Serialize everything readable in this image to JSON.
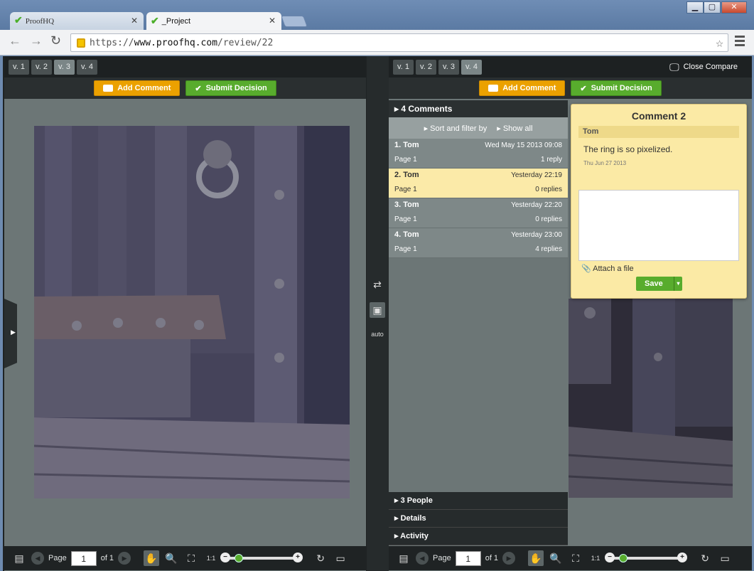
{
  "browser": {
    "tabs": [
      {
        "label": "ProofHQ"
      },
      {
        "label": "_Project"
      }
    ],
    "url_prefix": "https://",
    "url_host": "www.proofhq.com",
    "url_path": "/review/22"
  },
  "left": {
    "versions": [
      "v. 1",
      "v. 2",
      "v. 3",
      "v. 4"
    ],
    "selected_version": "v. 3",
    "add_comment": "Add Comment",
    "submit_decision": "Submit Decision",
    "page_label": "Page",
    "page_value": "1",
    "page_of": "of 1"
  },
  "right": {
    "versions": [
      "v. 1",
      "v. 2",
      "v. 3",
      "v. 4"
    ],
    "selected_version": "v. 4",
    "close_compare": "Close Compare",
    "add_comment": "Add Comment",
    "submit_decision": "Submit Decision",
    "page_label": "Page",
    "page_value": "1",
    "page_of": "of 1"
  },
  "comments": {
    "header": "4 Comments",
    "sort_label": "Sort and filter by",
    "show_all": "Show all",
    "items": [
      {
        "who": "1. Tom",
        "date": "Wed May 15 2013 09:08",
        "page": "Page 1",
        "replies": "1 reply"
      },
      {
        "who": "2. Tom",
        "date": "Yesterday 22:19",
        "page": "Page 1",
        "replies": "0 replies"
      },
      {
        "who": "3. Tom",
        "date": "Yesterday 22:20",
        "page": "Page 1",
        "replies": "0 replies"
      },
      {
        "who": "4. Tom",
        "date": "Yesterday 23:00",
        "page": "Page 1",
        "replies": "4 replies"
      }
    ],
    "sections": [
      "3 People",
      "Details",
      "Activity"
    ]
  },
  "popup": {
    "title": "Comment 2",
    "author": "Tom",
    "text": "The ring is so pixelized.",
    "date": "Thu Jun 27 2013",
    "attach": "Attach a file",
    "save": "Save"
  },
  "icons": [
    "back-icon",
    "forward-icon",
    "reload-icon",
    "lock-icon",
    "star-icon",
    "menu-icon",
    "compare-icon",
    "swap-icon",
    "lock-view-icon",
    "auto-icon",
    "pages-icon",
    "hand-icon",
    "zoom-icon",
    "fit-icon",
    "actual-size-icon",
    "rotate-icon",
    "ruler-icon",
    "paperclip-icon",
    "check-icon",
    "comment-icon"
  ]
}
